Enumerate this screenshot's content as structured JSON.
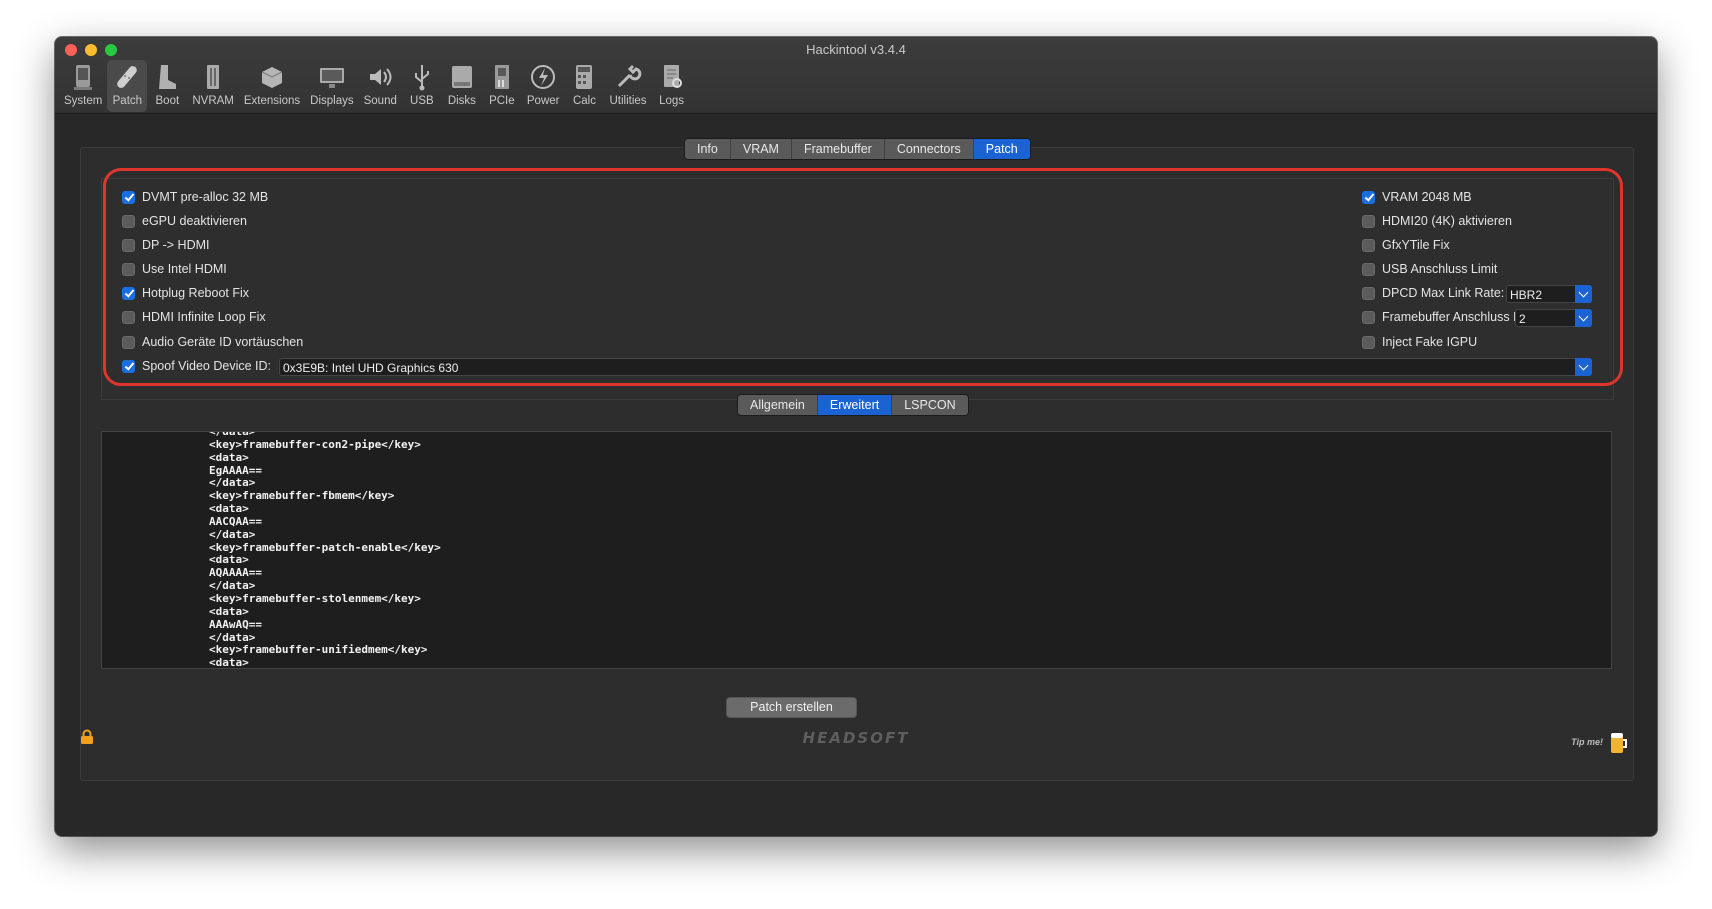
{
  "window": {
    "title": "Hackintool v3.4.4"
  },
  "toolbar": {
    "items": [
      {
        "label": "System",
        "icon": "system-icon"
      },
      {
        "label": "Patch",
        "icon": "patch-icon",
        "active": true
      },
      {
        "label": "Boot",
        "icon": "boot-icon"
      },
      {
        "label": "NVRAM",
        "icon": "nvram-icon"
      },
      {
        "label": "Extensions",
        "icon": "extensions-icon"
      },
      {
        "label": "Displays",
        "icon": "displays-icon"
      },
      {
        "label": "Sound",
        "icon": "sound-icon"
      },
      {
        "label": "USB",
        "icon": "usb-icon"
      },
      {
        "label": "Disks",
        "icon": "disks-icon"
      },
      {
        "label": "PCIe",
        "icon": "pcie-icon"
      },
      {
        "label": "Power",
        "icon": "power-icon"
      },
      {
        "label": "Calc",
        "icon": "calc-icon"
      },
      {
        "label": "Utilities",
        "icon": "utilities-icon"
      },
      {
        "label": "Logs",
        "icon": "logs-icon"
      }
    ]
  },
  "tabs": {
    "items": [
      "Info",
      "VRAM",
      "Framebuffer",
      "Connectors",
      "Patch"
    ],
    "selected": "Patch"
  },
  "options": {
    "left": [
      {
        "label": "DVMT pre-alloc 32 MB",
        "checked": true
      },
      {
        "label": "eGPU deaktivieren",
        "checked": false
      },
      {
        "label": "DP -> HDMI",
        "checked": false
      },
      {
        "label": "Use Intel HDMI",
        "checked": false
      },
      {
        "label": "Hotplug Reboot Fix",
        "checked": true
      },
      {
        "label": "HDMI Infinite Loop Fix",
        "checked": false
      },
      {
        "label": "Audio Geräte ID vortäuschen",
        "checked": false
      }
    ],
    "right": [
      {
        "label": "VRAM 2048 MB",
        "checked": true
      },
      {
        "label": "HDMI20 (4K) aktivieren",
        "checked": false
      },
      {
        "label": "GfxYTile Fix",
        "checked": false
      },
      {
        "label": "USB Anschluss Limit",
        "checked": false
      },
      {
        "label": "DPCD Max Link Rate:",
        "checked": false
      },
      {
        "label": "Framebuffer Anschluss L",
        "checked": false
      },
      {
        "label": "Inject Fake IGPU",
        "checked": false
      }
    ],
    "dpcd_value": "HBR2",
    "fb_value": "2",
    "spoof": {
      "label": "Spoof Video Device ID:",
      "checked": true,
      "value": "0x3E9B: Intel UHD Graphics 630"
    }
  },
  "subtabs": {
    "items": [
      "Allgemein",
      "Erweitert",
      "LSPCON"
    ],
    "selected": "Erweitert"
  },
  "code": {
    "lines": [
      "</data>",
      "<key>framebuffer-con2-pipe</key>",
      "<data>",
      "EgAAAA==",
      "</data>",
      "<key>framebuffer-fbmem</key>",
      "<data>",
      "AACQAA==",
      "</data>",
      "<key>framebuffer-patch-enable</key>",
      "<data>",
      "AQAAAA==",
      "</data>",
      "<key>framebuffer-stolenmem</key>",
      "<data>",
      "AAAwAQ==",
      "</data>",
      "<key>framebuffer-unifiedmem</key>",
      "<data>"
    ]
  },
  "actions": {
    "create_patch": "Patch erstellen"
  },
  "footer": {
    "logo": "HEADSOFT",
    "tip": "Tip me!"
  },
  "colors": {
    "accent": "#1b63d3",
    "highlight": "#e0352c",
    "background": "#282828"
  }
}
